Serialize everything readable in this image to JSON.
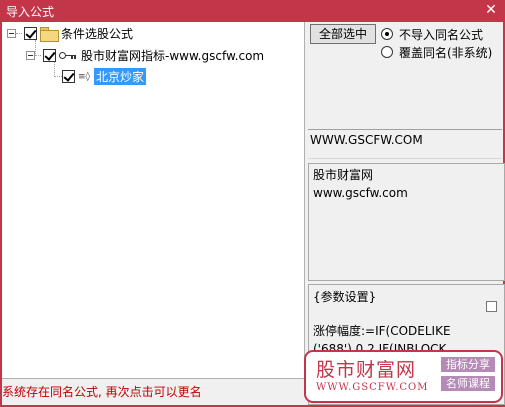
{
  "window": {
    "title": "导入公式",
    "close_glyph": "✕"
  },
  "tree": {
    "root": {
      "label": "条件选股公式",
      "checked": true
    },
    "child": {
      "label": "股市财富网指标-www.gscfw.com",
      "checked": true
    },
    "leaf": {
      "label": "北京炒家",
      "checked": true,
      "selected": true
    }
  },
  "controls": {
    "select_all_label": "全部选中",
    "radio_no_import": "不导入同名公式",
    "radio_overwrite": "覆盖同名(非系统)",
    "selected_radio": "no_import"
  },
  "info": {
    "url": "WWW.GSCFW.COM",
    "description_line1": "股市财富网",
    "description_line2": "www.gscfw.com",
    "param_header": "{参数设置}",
    "param_line1": "涨停幅度:=IF(CODELIKE",
    "param_line2": "('688'),0.2,IF(INBLOCK"
  },
  "status": {
    "message": "系统存在同名公式, 再次点击可以更名"
  },
  "watermark": {
    "name": "股市财富网",
    "url": "WWW.GSCFW.COM",
    "tag1": "指标分享",
    "tag2": "名师课程"
  },
  "colors": {
    "title_bar": "#c3364a",
    "selection": "#3399ff",
    "status_text": "#c00000",
    "watermark": "#c3364a",
    "tag_bg": "#b58ab7"
  },
  "icons": {
    "root": "folder-icon",
    "child": "key-icon",
    "leaf": "formula-leaf-icon"
  }
}
